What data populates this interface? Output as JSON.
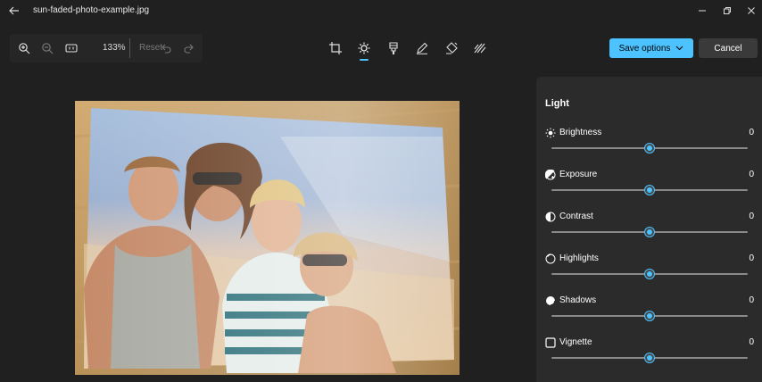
{
  "window": {
    "title": "sun-faded-photo-example.jpg"
  },
  "toolbar": {
    "zoom_level": "133%",
    "reset_label": "Reset"
  },
  "actions": {
    "save_label": "Save options",
    "cancel_label": "Cancel"
  },
  "tools": [
    {
      "name": "crop-icon",
      "active": false
    },
    {
      "name": "brightness-icon",
      "active": true
    },
    {
      "name": "filter-icon",
      "active": false
    },
    {
      "name": "markup-icon",
      "active": false
    },
    {
      "name": "erase-icon",
      "active": false
    },
    {
      "name": "background-icon",
      "active": false
    }
  ],
  "panel": {
    "title": "Light",
    "sliders": [
      {
        "label": "Brightness",
        "value": "0",
        "icon": "sun-icon",
        "level": 0.5
      },
      {
        "label": "Exposure",
        "value": "0",
        "icon": "exposure-icon",
        "level": 0.5
      },
      {
        "label": "Contrast",
        "value": "0",
        "icon": "contrast-icon",
        "level": 0.5
      },
      {
        "label": "Highlights",
        "value": "0",
        "icon": "highlights-icon",
        "level": 0.5
      },
      {
        "label": "Shadows",
        "value": "0",
        "icon": "shadows-icon",
        "level": 0.5
      },
      {
        "label": "Vignette",
        "value": "0",
        "icon": "vignette-icon",
        "level": 0.5
      }
    ]
  },
  "colors": {
    "accent": "#4cc2ff",
    "background": "#202020",
    "panel": "#2b2b2b"
  }
}
